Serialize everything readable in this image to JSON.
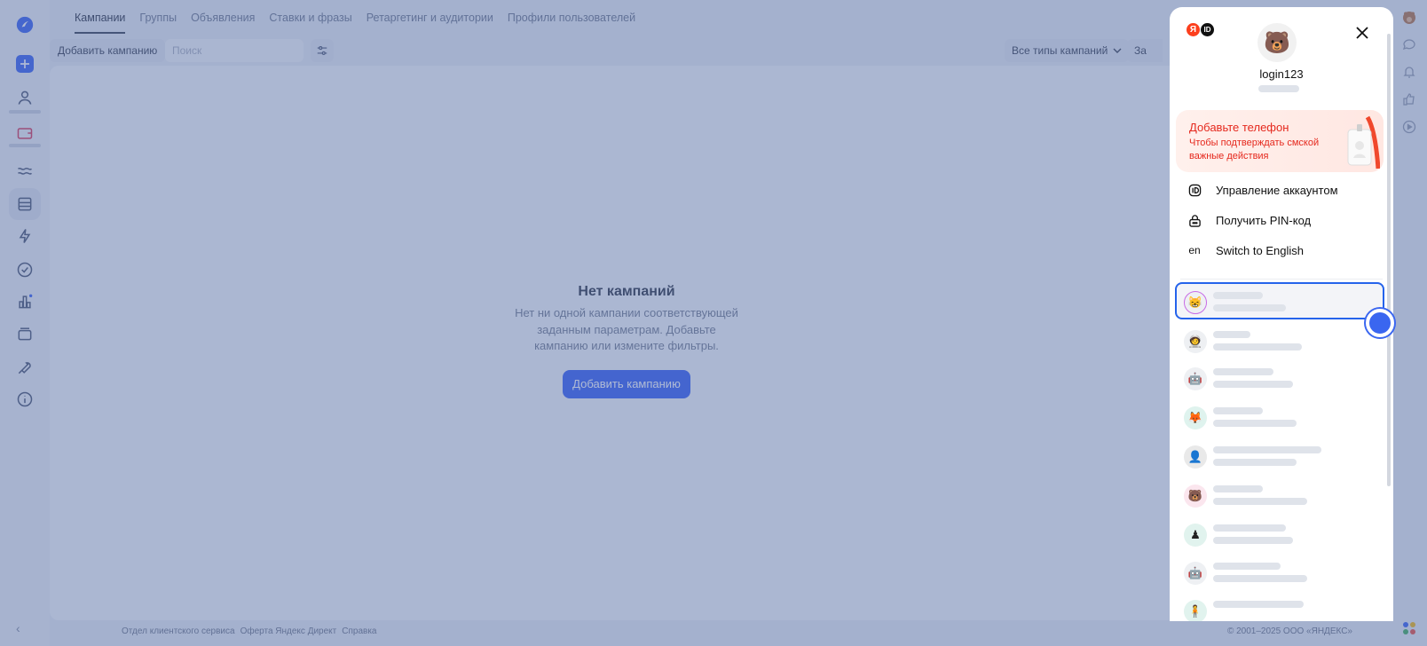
{
  "colors": {
    "accent": "#2955f4",
    "selection": "#2563eb",
    "phone_red": "#e5281d",
    "overlay": "rgba(95,118,170,0.5)"
  },
  "left_rail": {
    "icons": [
      "logo-icon",
      "plus-icon",
      "user-icon",
      "wallet-icon",
      "wave-icon",
      "list-icon",
      "bolt-icon",
      "check-circle-icon",
      "bar-chart-icon",
      "layers-icon",
      "wrench-icon",
      "info-icon"
    ],
    "collapse_glyph": "‹"
  },
  "tabs": [
    {
      "label": "Кампании",
      "active": true
    },
    {
      "label": "Группы",
      "active": false
    },
    {
      "label": "Объявления",
      "active": false
    },
    {
      "label": "Ставки и фразы",
      "active": false
    },
    {
      "label": "Ретаргетинг и аудитории",
      "active": false
    },
    {
      "label": "Профили пользователей",
      "active": false
    }
  ],
  "toolbar": {
    "add_label": "Добавить кампанию",
    "search_placeholder": "Поиск",
    "campaign_types": "Все типы кампаний",
    "second_select": "За"
  },
  "empty_state": {
    "title": "Нет кампаний",
    "text": "Нет ни одной кампании соответствующей заданным параметрам. Добавьте кампанию или измените фильтры.",
    "button": "Добавить кампанию"
  },
  "footer": {
    "links": [
      "Отдел клиентского сервиса",
      "Оферта Яндекс Директ",
      "Справка"
    ],
    "copyright": "© 2001–2025 ООО «ЯНДЕКС»"
  },
  "popup": {
    "logo_ya": "Я",
    "logo_id": "ID",
    "login": "login123",
    "avatar_emoji": "🐻",
    "phone_card": {
      "title": "Добавьте телефон",
      "text": "Чтобы подтверждать смской важные действия"
    },
    "menu": [
      {
        "icon": "id-icon",
        "glyph": "ID",
        "label": "Управление аккаунтом"
      },
      {
        "icon": "lock-icon",
        "glyph": "",
        "label": "Получить PIN-код"
      },
      {
        "icon": "language-icon",
        "glyph": "en",
        "label": "Switch to English"
      }
    ],
    "accounts": [
      {
        "emoji": "😸",
        "selected": true
      },
      {
        "emoji": "🧑‍🚀",
        "selected": false
      },
      {
        "emoji": "🤖",
        "selected": false
      },
      {
        "emoji": "🦊",
        "selected": false
      },
      {
        "emoji": "👤",
        "selected": false
      },
      {
        "emoji": "🐻",
        "selected": false
      },
      {
        "emoji": "♟",
        "selected": false
      },
      {
        "emoji": "🤖",
        "selected": false
      },
      {
        "emoji": "🧍",
        "selected": false
      }
    ]
  }
}
